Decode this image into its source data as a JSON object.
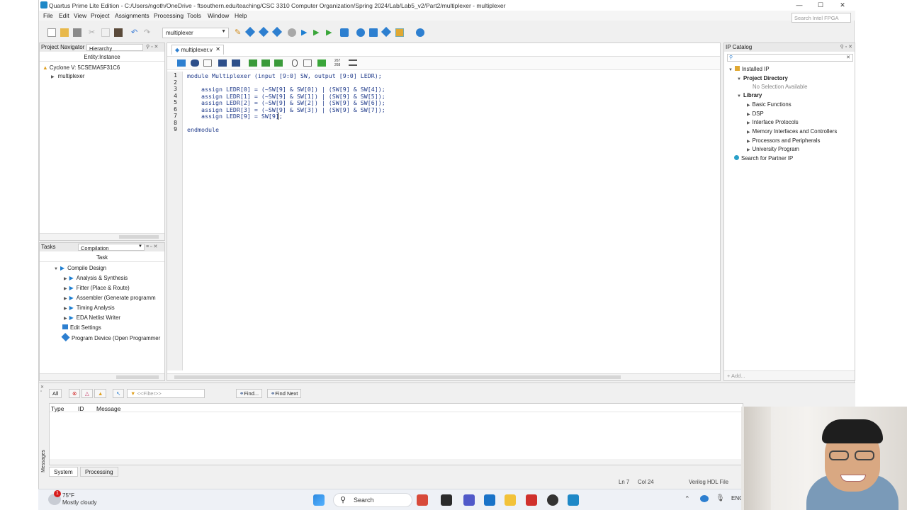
{
  "window": {
    "title": "Quartus Prime Lite Edition - C:/Users/ngoth/OneDrive - ftsouthern.edu/teaching/CSC 3310 Computer Organization/Spring 2024/Lab/Lab5_v2/Part2/multiplexer - multiplexer",
    "search_placeholder": "Search Intel FPGA",
    "minimize": "—",
    "maximize": "☐",
    "close": "✕"
  },
  "menu": [
    "File",
    "Edit",
    "View",
    "Project",
    "Assignments",
    "Processing",
    "Tools",
    "Window",
    "Help"
  ],
  "toolbar": {
    "project_combo": "multiplexer"
  },
  "project_navigator": {
    "title": "Project Navigator",
    "view_combo": "Hierarchy",
    "column_header": "Entity:Instance",
    "device": "Cyclone V: 5CSEMA5F31C6",
    "entity": "multiplexer"
  },
  "tasks": {
    "title": "Tasks",
    "flow_combo": "Compilation",
    "column_header": "Task",
    "items": [
      {
        "label": "Compile Design",
        "level": 1
      },
      {
        "label": "Analysis & Synthesis",
        "level": 2
      },
      {
        "label": "Fitter (Place & Route)",
        "level": 2
      },
      {
        "label": "Assembler (Generate programm",
        "level": 2
      },
      {
        "label": "Timing Analysis",
        "level": 2
      },
      {
        "label": "EDA Netlist Writer",
        "level": 2
      },
      {
        "label": "Edit Settings",
        "level": 0
      },
      {
        "label": "Program Device (Open Programmer",
        "level": 0
      }
    ]
  },
  "editor": {
    "tab_label": "multiplexer.v",
    "tab_close": "✕",
    "line_numbers": [
      "1",
      "2",
      "3",
      "4",
      "5",
      "6",
      "7",
      "8",
      "9"
    ],
    "lines": [
      "module Multiplexer (input [9:0] SW, output [9:0] LEDR);",
      "",
      "    assign LEDR[0] = (~SW[9] & SW[0]) | (SW[9] & SW[4]);",
      "    assign LEDR[1] = (~SW[9] & SW[1]) | (SW[9] & SW[5]);",
      "    assign LEDR[2] = (~SW[9] & SW[2]) | (SW[9] & SW[6]);",
      "    assign LEDR[3] = (~SW[9] & SW[3]) | (SW[9] & SW[7]);",
      "    assign LEDR[9] = SW[9];",
      "",
      "endmodule"
    ]
  },
  "ip_catalog": {
    "title": "IP Catalog",
    "items": [
      {
        "label": "Installed IP",
        "level": 0,
        "bold": false
      },
      {
        "label": "Project Directory",
        "level": 1,
        "bold": true
      },
      {
        "label": "No Selection Available",
        "level": 3,
        "bold": false
      },
      {
        "label": "Library",
        "level": 1,
        "bold": true
      },
      {
        "label": "Basic Functions",
        "level": 2,
        "bold": false
      },
      {
        "label": "DSP",
        "level": 2,
        "bold": false
      },
      {
        "label": "Interface Protocols",
        "level": 2,
        "bold": false
      },
      {
        "label": "Memory Interfaces and Controllers",
        "level": 2,
        "bold": false
      },
      {
        "label": "Processors and Peripherals",
        "level": 2,
        "bold": false
      },
      {
        "label": "University Program",
        "level": 2,
        "bold": false
      },
      {
        "label": "Search for Partner IP",
        "level": 0,
        "bold": false
      }
    ],
    "add_button": "+ Add..."
  },
  "messages": {
    "all_label": "All",
    "filter_placeholder": "<<Filter>>",
    "find_label": "Find...",
    "find_next_label": "Find Next",
    "columns": [
      "Type",
      "ID",
      "Message"
    ],
    "side_label": "Messages",
    "tabs": [
      "System",
      "Processing"
    ]
  },
  "status": {
    "ln": "Ln 7",
    "col": "Col 24",
    "file_type": "Verilog HDL File"
  },
  "taskbar": {
    "weather_temp": "75°F",
    "weather_desc": "Mostly cloudy",
    "search_label": "Search",
    "lang": "ENG",
    "notification_badge": "1"
  }
}
